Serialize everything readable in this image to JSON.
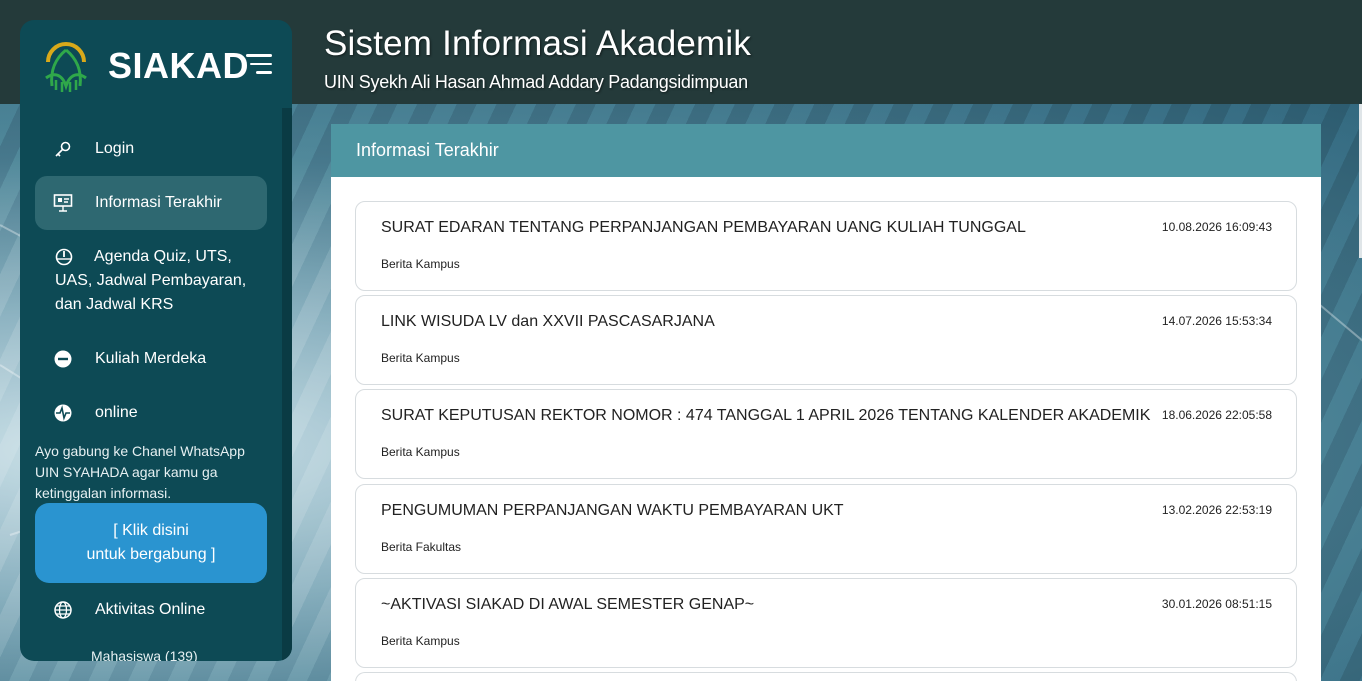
{
  "header": {
    "title": "Sistem Informasi Akademik",
    "subtitle": "UIN Syekh Ali Hasan Ahmad Addary Padangsidimpuan"
  },
  "sidebar": {
    "brand": "SIAKAD",
    "items": [
      {
        "label": "Login",
        "icon": "key-icon"
      },
      {
        "label": "Informasi Terakhir",
        "icon": "presentation-board-icon",
        "active": true
      },
      {
        "label": "Agenda Quiz, UTS, UAS, Jadwal Pembayaran, dan Jadwal KRS",
        "icon": "gauge-icon"
      },
      {
        "label": "Kuliah Merdeka",
        "icon": "minus-circle-icon"
      },
      {
        "label": "online",
        "icon": "pulse-icon"
      }
    ],
    "whatsapp_text": "Ayo gabung ke Chanel WhatsApp UIN SYAHADA agar kamu ga ketinggalan informasi.",
    "whatsapp_button_line1": "[ Klik disini",
    "whatsapp_button_line2": "untuk bergabung ]",
    "online_activity": {
      "label": "Aktivitas Online",
      "icon": "globe-icon"
    },
    "online_sub": "Mahasiswa (139)"
  },
  "panel": {
    "header": "Informasi Terakhir",
    "items": [
      {
        "title": "SURAT EDARAN TENTANG PERPANJANGAN PEMBAYARAN UANG KULIAH TUNGGAL",
        "date": "10.08.2026 16:09:43",
        "category": "Berita Kampus"
      },
      {
        "title": "LINK WISUDA LV dan XXVII PASCASARJANA",
        "date": "14.07.2026 15:53:34",
        "category": "Berita Kampus"
      },
      {
        "title": "SURAT KEPUTUSAN REKTOR NOMOR : 474 TANGGAL 1 APRIL 2026 TENTANG KALENDER AKADEMIK",
        "date": "18.06.2026 22:05:58",
        "category": "Berita Kampus"
      },
      {
        "title": "PENGUMUMAN PERPANJANGAN WAKTU PEMBAYARAN UKT",
        "date": "13.02.2026 22:53:19",
        "category": "Berita Fakultas"
      },
      {
        "title": "~AKTIVASI SIAKAD DI AWAL SEMESTER GENAP~",
        "date": "30.01.2026 08:51:15",
        "category": "Berita Kampus"
      }
    ]
  },
  "colors": {
    "topbar": "#243a3a",
    "sidebar": "#0d4a55",
    "sidebar_active": "#2e6871",
    "panel_header": "#4e96a2",
    "whatsapp_button": "#2a94d0",
    "logo_gold": "#d9a91a",
    "logo_green": "#2fa84a"
  }
}
